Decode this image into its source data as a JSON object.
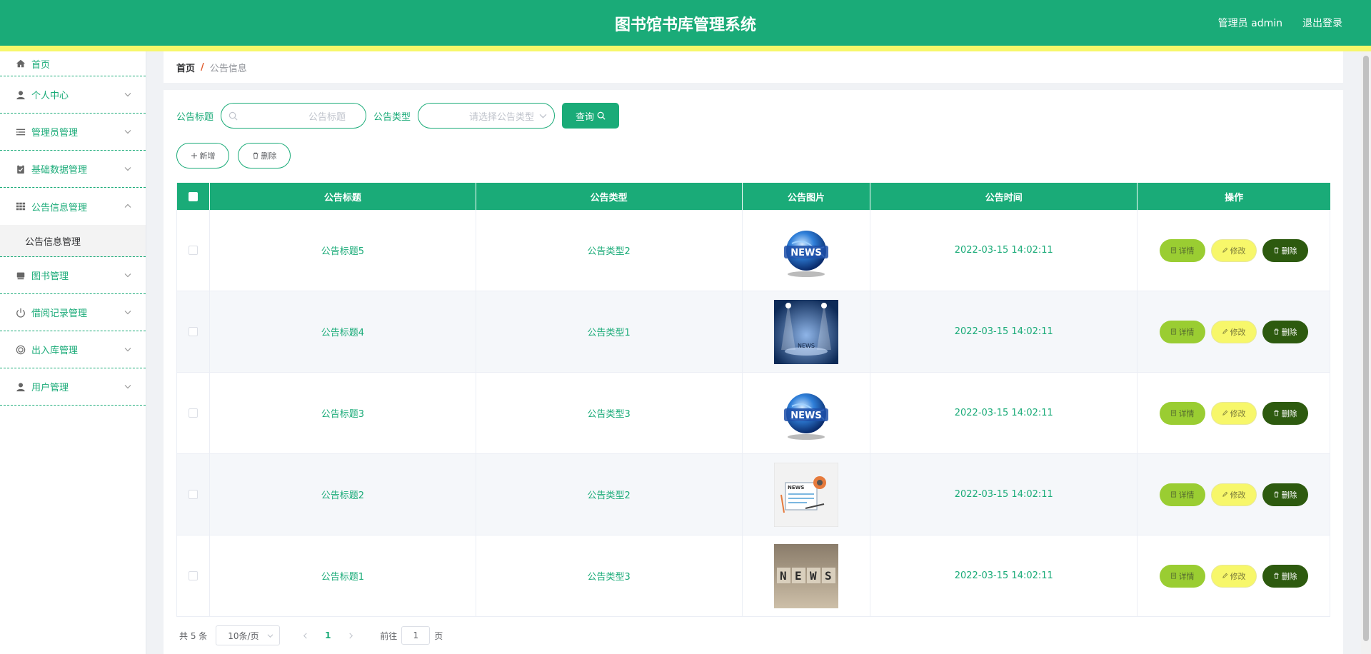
{
  "header": {
    "title": "图书馆书库管理系统",
    "user": "管理员 admin",
    "logout": "退出登录"
  },
  "sidebar": {
    "items": [
      {
        "label": "首页",
        "icon": "home-icon"
      },
      {
        "label": "个人中心",
        "icon": "user-icon"
      },
      {
        "label": "管理员管理",
        "icon": "list-icon"
      },
      {
        "label": "基础数据管理",
        "icon": "clipboard-icon"
      },
      {
        "label": "公告信息管理",
        "icon": "grid-icon"
      },
      {
        "label": "图书管理",
        "icon": "book-icon"
      },
      {
        "label": "借阅记录管理",
        "icon": "power-icon"
      },
      {
        "label": "出入库管理",
        "icon": "circle-icon"
      },
      {
        "label": "用户管理",
        "icon": "user-icon"
      }
    ],
    "submenu": [
      "公告信息管理"
    ]
  },
  "breadcrumb": {
    "home": "首页",
    "sep": "/",
    "current": "公告信息"
  },
  "search": {
    "title_label": "公告标题",
    "title_placeholder": "公告标题",
    "type_label": "公告类型",
    "type_placeholder": "请选择公告类型",
    "query_label": "查询"
  },
  "actions": {
    "add_label": "新增",
    "delete_label": "删除"
  },
  "table": {
    "columns": [
      "公告标题",
      "公告类型",
      "公告图片",
      "公告时间",
      "操作"
    ],
    "rows": [
      {
        "title": "公告标题5",
        "type": "公告类型2",
        "image": "globe-news",
        "time": "2022-03-15 14:02:11"
      },
      {
        "title": "公告标题4",
        "type": "公告类型1",
        "image": "stage-news",
        "time": "2022-03-15 14:02:11"
      },
      {
        "title": "公告标题3",
        "type": "公告类型3",
        "image": "globe-news",
        "time": "2022-03-15 14:02:11"
      },
      {
        "title": "公告标题2",
        "type": "公告类型2",
        "image": "paper-news",
        "time": "2022-03-15 14:02:11"
      },
      {
        "title": "公告标题1",
        "type": "公告类型3",
        "image": "block-news",
        "time": "2022-03-15 14:02:11"
      }
    ],
    "op_detail": "详情",
    "op_edit": "修改",
    "op_delete": "删除"
  },
  "pagination": {
    "total": "共 5 条",
    "page_size": "10条/页",
    "current_page": "1",
    "goto_prefix": "前往",
    "goto_value": "1",
    "goto_suffix": "页"
  },
  "colors": {
    "primary": "#1aab78",
    "accent_yellow": "#f7f76a",
    "detail_btn": "#9acd32",
    "delete_btn": "#2d5a0f"
  }
}
